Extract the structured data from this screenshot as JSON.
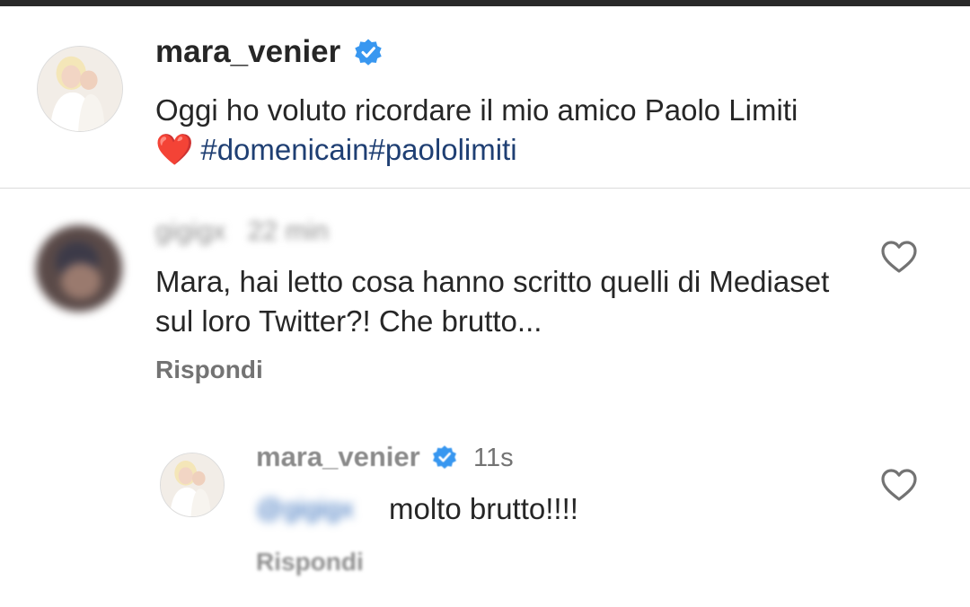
{
  "post": {
    "username": "mara_venier",
    "caption_line1": "Oggi ho voluto ricordare il mio amico Paolo Limiti",
    "caption_emoji": "❤️",
    "caption_hashtags": "#domenicain#paololimiti"
  },
  "comments": [
    {
      "username": "gigigx",
      "time": "22 min",
      "text": "Mara, hai letto cosa hanno scritto quelli di Mediaset sul loro Twitter?! Che brutto...",
      "reply_label": "Rispondi"
    },
    {
      "username": "mara_venier",
      "time": "11s",
      "mention": "@gigigx",
      "text": "molto brutto!!!!",
      "reply_label": "Rispondi"
    }
  ],
  "icons": {
    "verified_badge": "verified-badge-icon",
    "like": "heart-outline-icon"
  },
  "colors": {
    "verified_blue": "#3897f0",
    "hashtag_blue": "#1f3f73",
    "heart_red": "#e0223c"
  }
}
